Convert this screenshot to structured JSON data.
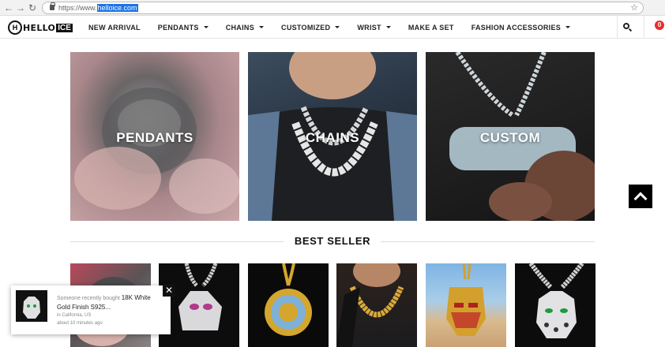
{
  "browser": {
    "back_icon": "back-arrow-icon",
    "forward_icon": "forward-arrow-icon",
    "reload_icon": "reload-icon",
    "url_prefix": "https://www.",
    "url_host": "helloice.com",
    "bookmark_icon": "star-icon"
  },
  "header": {
    "logo_mark": "H",
    "logo_text": "HELLO",
    "logo_accent": "ICE",
    "nav": [
      {
        "label": "NEW ARRIVAL"
      },
      {
        "label": "PENDANTS"
      },
      {
        "label": "CHAINS"
      },
      {
        "label": "CUSTOMIZED"
      },
      {
        "label": "WRIST"
      },
      {
        "label": "MAKE A SET"
      },
      {
        "label": "FASHION ACCESSORIES"
      }
    ],
    "search_icon": "search-icon",
    "cart_count": "0"
  },
  "categories": [
    {
      "label": "PENDANTS"
    },
    {
      "label": "CHAINS"
    },
    {
      "label": "CUSTOM"
    }
  ],
  "best_seller": {
    "heading": "BEST SELLER"
  },
  "popup": {
    "prefix": "Someone recently bought",
    "product_line1": "18K White",
    "product_line2": "Gold Finish S925...",
    "location": "in California, US",
    "time": "about 10 minutes ago",
    "close": "✕"
  },
  "colors": {
    "accent_red": "#e62e2e",
    "url_highlight": "#1a73e8"
  }
}
